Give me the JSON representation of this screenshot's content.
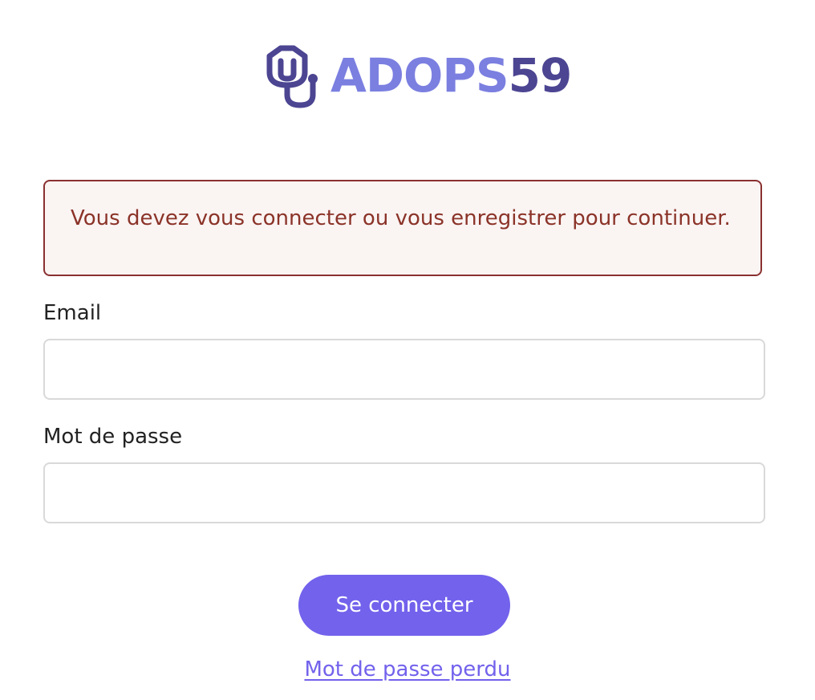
{
  "brand": {
    "logo_part1": "ADOPS",
    "logo_part2": "59",
    "logo_icon": "stethoscope-icon",
    "colors": {
      "light": "#7b7fe0",
      "dark": "#4c4592"
    }
  },
  "alert": {
    "message": "Vous devez vous connecter ou vous enregistrer pour continuer.",
    "text_color": "#8b3328",
    "border_color": "#8a3030",
    "background": "#faf4f3"
  },
  "form": {
    "email_label": "Email",
    "email_value": "",
    "password_label": "Mot de passe",
    "password_value": "",
    "submit_label": "Se connecter",
    "forgot_password_label": "Mot de passe perdu",
    "accent_color": "#7262ec"
  }
}
